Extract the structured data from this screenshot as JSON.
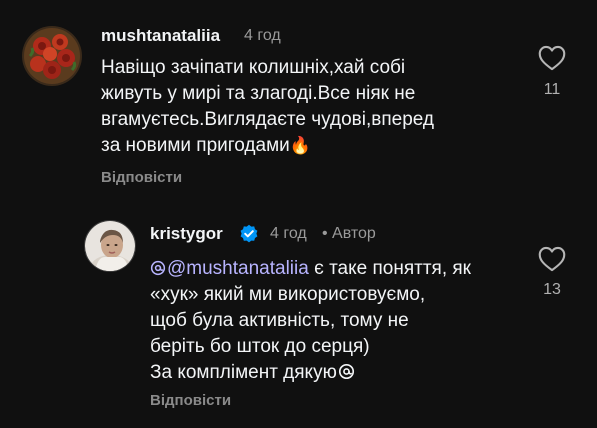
{
  "comments": [
    {
      "username": "mushtanataliia",
      "time": "4 год",
      "text_lines": [
        "Навіщо зачіпати колишніх,хай собі",
        "живуть у мирі та злагоді.Все ніяк не",
        "вгамуєтесь.Виглядаєте чудові,вперед",
        "за новими пригодами"
      ],
      "emoji": "🔥",
      "emoji_icon": "fire-emoji",
      "reply_label": "Відповісти",
      "likes": "11"
    },
    {
      "username": "kristygor",
      "verified": true,
      "time": "4 год",
      "author_badge": "• Автор",
      "mention": "@mushtanataliia",
      "text_line1_rest": " є таке поняття, як",
      "text_lines": [
        "«хук» який ми використовуємо,",
        "щоб була активність, тому не",
        "беріть бо шток до серця)",
        "За комплімент дякую"
      ],
      "trailing_icon": "threads-logo-icon",
      "reply_label": "Відповісти",
      "likes": "13"
    }
  ],
  "colors": {
    "background": "#101010",
    "text": "#f3f5f7",
    "muted": "#9a9a9a",
    "mention": "#b8b4ff",
    "verified": "#0095f6"
  }
}
